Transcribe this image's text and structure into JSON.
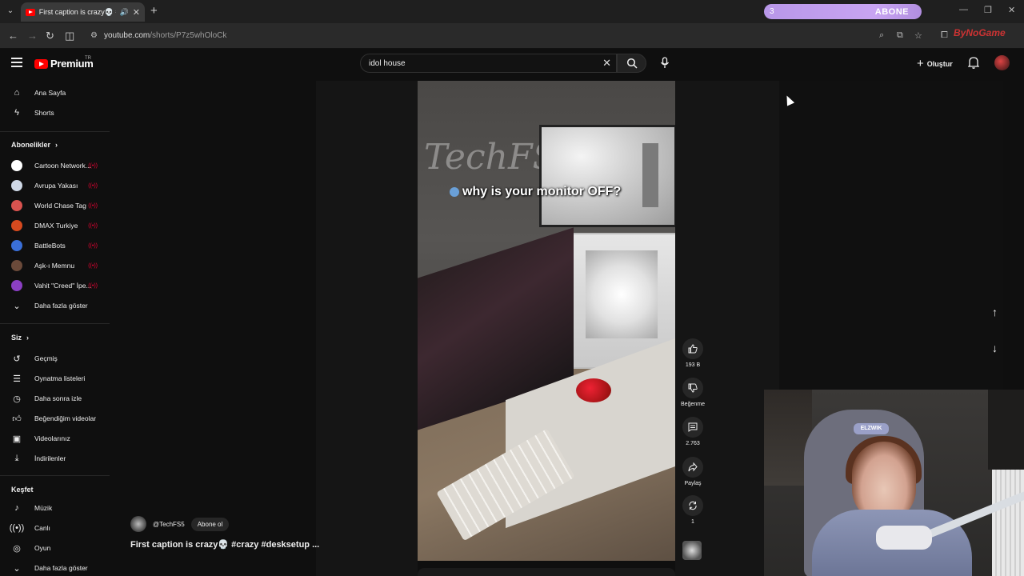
{
  "browser": {
    "tab_title": "First caption is crazy💀 #cr",
    "url_domain": "youtube.com",
    "url_path": "/shorts/P7z5whOloCk",
    "overlay": {
      "count": "3",
      "label": "ABONE"
    },
    "ext_brand": "ByNoGame"
  },
  "header": {
    "logo_text": "Premium",
    "logo_region": "TR",
    "search_value": "idol house",
    "create_label": "Oluştur"
  },
  "sidebar": {
    "main": [
      {
        "label": "Ana Sayfa",
        "icon": "home-icon"
      },
      {
        "label": "Shorts",
        "icon": "shorts-icon"
      }
    ],
    "subs_title": "Abonelikler",
    "subs": [
      {
        "label": "Cartoon Network...",
        "color": "#ffffff"
      },
      {
        "label": "Avrupa Yakası",
        "color": "#cfd8e6"
      },
      {
        "label": "World Chase Tag",
        "color": "#d9534f"
      },
      {
        "label": "DMAX Turkiye",
        "color": "#d64a1f"
      },
      {
        "label": "BattleBots",
        "color": "#3a6fd8"
      },
      {
        "label": "Aşk-ı Memnu",
        "color": "#6b4a3a"
      },
      {
        "label": "Vahit \"Creed\" İpe...",
        "color": "#8b3fc4"
      }
    ],
    "subs_more": "Daha fazla göster",
    "you_title": "Siz",
    "you": [
      {
        "label": "Geçmiş",
        "icon": "history-icon"
      },
      {
        "label": "Oynatma listeleri",
        "icon": "playlist-icon"
      },
      {
        "label": "Daha sonra izle",
        "icon": "clock-icon"
      },
      {
        "label": "Beğendiğim videolar",
        "icon": "like-icon"
      },
      {
        "label": "Videolarınız",
        "icon": "video-icon"
      },
      {
        "label": "İndirilenler",
        "icon": "download-icon"
      }
    ],
    "explore_title": "Keşfet",
    "explore": [
      {
        "label": "Müzik",
        "icon": "music-icon"
      },
      {
        "label": "Canlı",
        "icon": "live-icon"
      },
      {
        "label": "Oyun",
        "icon": "gaming-icon"
      }
    ],
    "explore_more": "Daha fazla göster"
  },
  "short": {
    "caption": "why is your monitor OFF?",
    "wall_text": "TechFS",
    "channel": "@TechFS5",
    "subscribe": "Abone ol",
    "title": "First caption is crazy💀 #crazy #desksetup ...",
    "actions": {
      "likes": "193 B",
      "dislike": "Beğenme",
      "comments": "2.763",
      "share": "Paylaş",
      "remix": "1"
    }
  },
  "webcam": {
    "chair_logo": "ELZWIK"
  }
}
